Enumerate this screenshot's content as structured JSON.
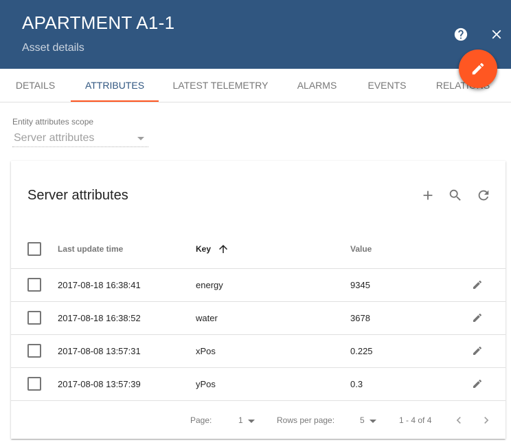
{
  "header": {
    "title": "APARTMENT A1-1",
    "subtitle": "Asset details",
    "icons": {
      "help": "help-circle-icon",
      "close": "close-icon",
      "fab": "pencil-icon"
    },
    "colors": {
      "header_bg": "#305680",
      "accent": "#ff5722"
    }
  },
  "tabs": [
    {
      "label": "DETAILS"
    },
    {
      "label": "ATTRIBUTES",
      "active": true
    },
    {
      "label": "LATEST TELEMETRY"
    },
    {
      "label": "ALARMS"
    },
    {
      "label": "EVENTS"
    },
    {
      "label": "RELATIONS"
    }
  ],
  "scope": {
    "label": "Entity attributes scope",
    "value": "Server attributes"
  },
  "table": {
    "title": "Server attributes",
    "columns": {
      "time": "Last update time",
      "key": "Key",
      "value": "Value"
    },
    "sort": {
      "column": "key",
      "direction": "ascending",
      "icon": "arrow-up-icon"
    },
    "rows": [
      {
        "time": "2017-08-18 16:38:41",
        "key": "energy",
        "value": "9345"
      },
      {
        "time": "2017-08-18 16:38:52",
        "key": "water",
        "value": "3678"
      },
      {
        "time": "2017-08-08 13:57:31",
        "key": "xPos",
        "value": "0.225"
      },
      {
        "time": "2017-08-08 13:57:39",
        "key": "yPos",
        "value": "0.3"
      }
    ]
  },
  "pagination": {
    "page_label": "Page:",
    "page_value": "1",
    "rows_label": "Rows per page:",
    "rows_value": "5",
    "range": "1 - 4 of 4"
  }
}
